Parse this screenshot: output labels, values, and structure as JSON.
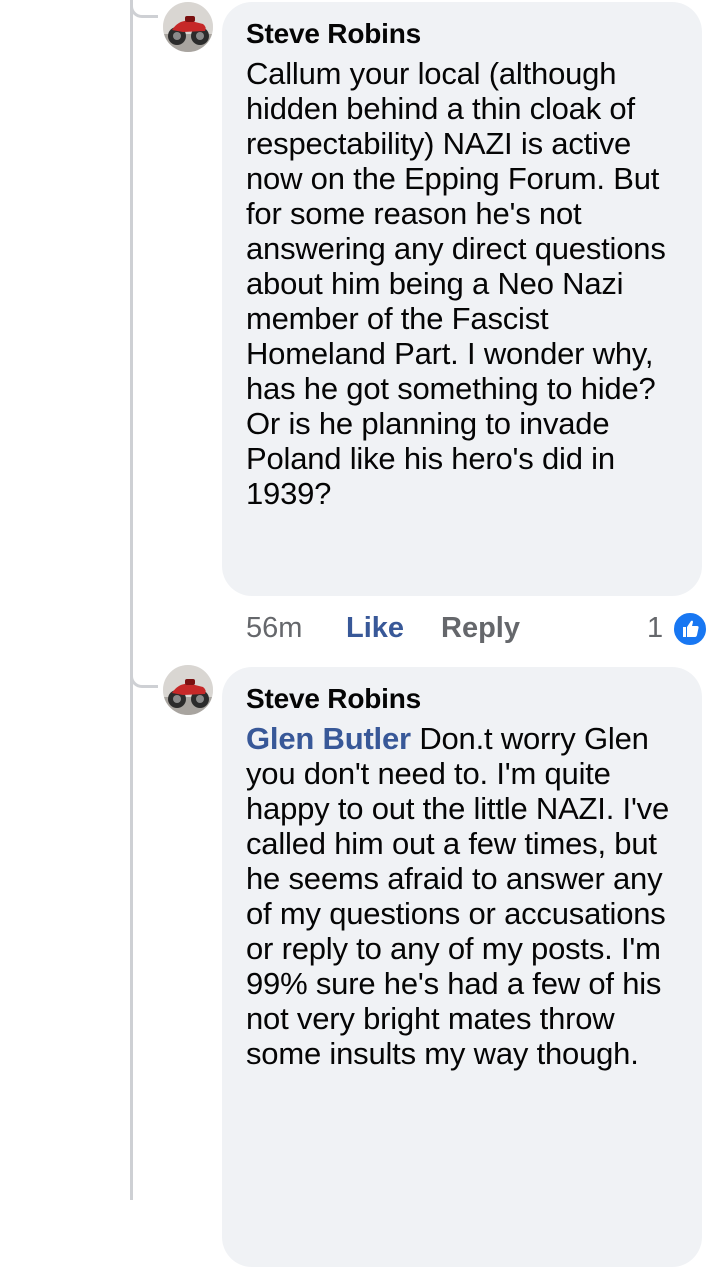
{
  "comments": [
    {
      "author": "Steve Robins",
      "avatar_icon": "motorcycle-avatar-icon",
      "text": "Callum your local (although hidden behind a thin cloak of respectability) NAZI is active now on the Epping Forum. But for some reason he's not answering any direct questions about him being a Neo Nazi member of the Fascist Homeland Part. I wonder why, has he got something to hide? Or is he planning to invade Poland like his hero's did in 1939?",
      "time": "56m",
      "like_label": "Like",
      "reply_label": "Reply",
      "reaction_count": "1",
      "reaction_icon": "thumbs-up-icon"
    },
    {
      "author": "Steve Robins",
      "avatar_icon": "motorcycle-avatar-icon",
      "mention": "Glen Butler",
      "text": "Don.t worry Glen you don't need to. I'm quite happy to out the little NAZI. I've called him out a few times, but he seems afraid to answer any of my questions or accusations or reply to any of my posts. I'm 99% sure he's had a few of his not very bright mates throw some insults my way though."
    }
  ],
  "colors": {
    "bubble": "#f0f2f5",
    "mention": "#385898",
    "meta": "#65676b",
    "like_badge": "#1877f2",
    "thread_line": "#ced0d4"
  }
}
